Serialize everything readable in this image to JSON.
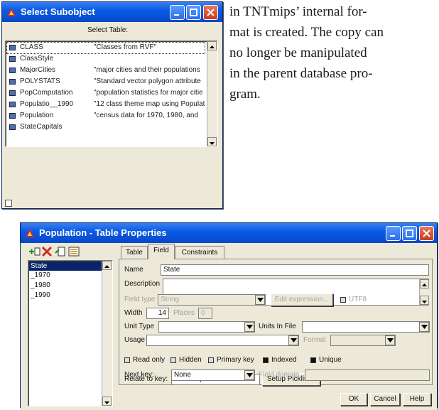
{
  "document": {
    "lines": [
      "in TNTmips’ internal for-",
      "mat is created. The copy can",
      "no longer be manipulated",
      "in the parent database pro-",
      "gram."
    ]
  },
  "subobject_window": {
    "title": "Select Subobject",
    "header": "Select Table:",
    "items": [
      {
        "name": "CLASS",
        "desc": "\"Classes from RVF\""
      },
      {
        "name": "ClassStyle",
        "desc": ""
      },
      {
        "name": "MajorCities",
        "desc": "\"major cities and their populations"
      },
      {
        "name": "POLYSTATS",
        "desc": "\"Standard vector polygon attribute"
      },
      {
        "name": "PopComputation",
        "desc": "\"population statistics for major citie"
      },
      {
        "name": "Populatio__1990",
        "desc": "\"12 class theme map using Populat"
      },
      {
        "name": "Population",
        "desc": "\"census data for 1970, 1980, and"
      },
      {
        "name": "StateCapitals",
        "desc": ""
      }
    ]
  },
  "table_properties": {
    "title": "Population - Table Properties",
    "fields": [
      "State",
      "_1970",
      "_1980",
      "_1990"
    ],
    "tabs": [
      "Table",
      "Field",
      "Constraints"
    ],
    "active_tab": "Field",
    "name_label": "Name",
    "name_value": "State",
    "description_label": "Description",
    "description_value": "",
    "field_type_label": "Field type",
    "field_type_value": "String",
    "edit_expression_label": "Edit expression...",
    "utf8_label": "UTF8",
    "width_label": "Width",
    "width_value": "14",
    "places_label": "Places",
    "places_value": "0",
    "unit_type_label": "Unit Type",
    "unit_type_value": "",
    "units_in_file_label": "Units In File",
    "units_in_file_value": "",
    "usage_label": "Usage",
    "usage_value": "",
    "format_label": "Format",
    "format_value": "",
    "checkboxes": [
      {
        "label": "Read only",
        "checked": false
      },
      {
        "label": "Hidden",
        "checked": false
      },
      {
        "label": "Primary key",
        "checked": false
      },
      {
        "label": "Indexed",
        "checked": true
      },
      {
        "label": "Unique",
        "checked": true
      }
    ],
    "relate_label": "Relate to key:",
    "relate_value": "StateCapitals.State",
    "setup_picklist_label": "Setup Picklist...",
    "next_key_label": "Next key:",
    "next_key_value": "None",
    "field_domain_label": "Field domain",
    "field_domain_value": "",
    "ok_label": "OK",
    "cancel_label": "Cancel",
    "help_label": "Help"
  },
  "colors": {
    "titlebar": "#0a5ce6",
    "window_bg": "#ece9d8",
    "selection": "#0a246a",
    "close_button": "#c83d1a"
  }
}
